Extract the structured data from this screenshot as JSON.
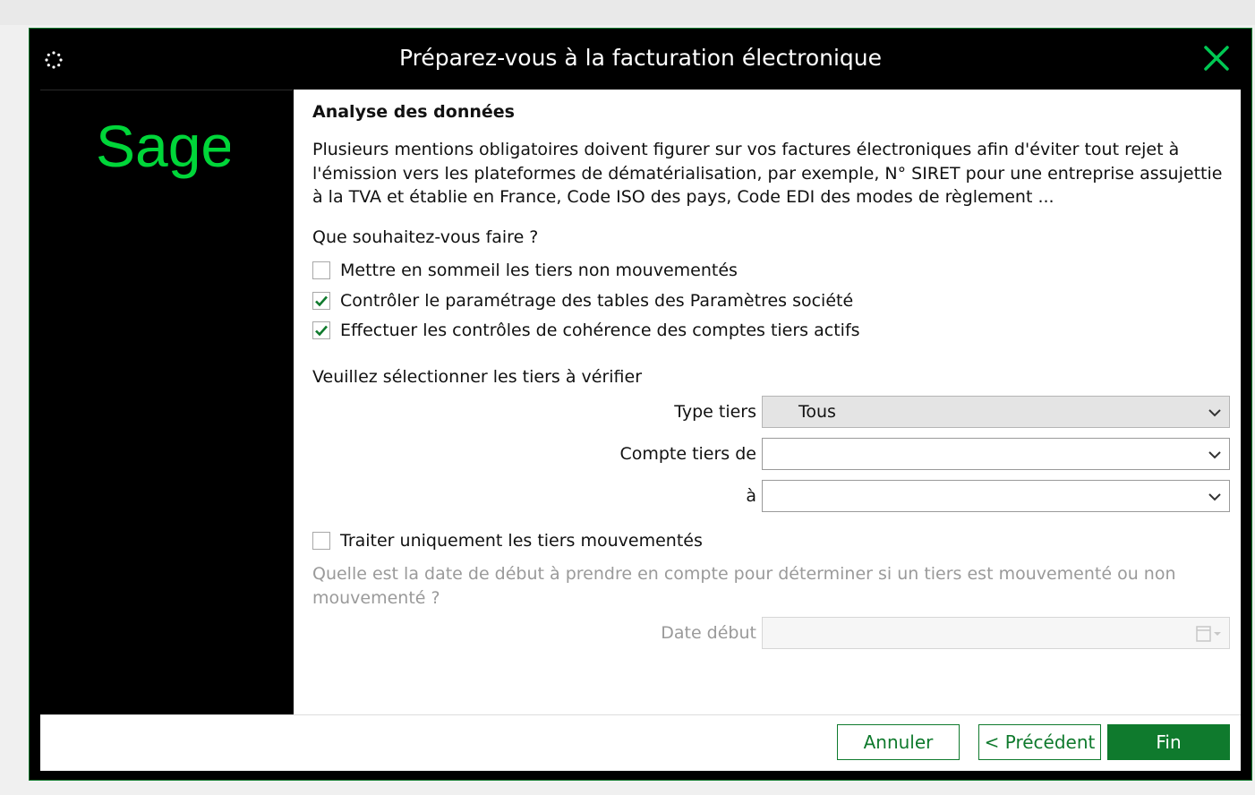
{
  "window": {
    "title": "Préparez-vous à la facturation électronique"
  },
  "sidebar": {
    "logo_text": "Sage"
  },
  "main": {
    "heading": "Analyse des données",
    "description": "Plusieurs mentions obligatoires doivent figurer sur vos factures électroniques afin d'éviter tout rejet à l'émission vers les plateformes de dématérialisation, par exemple, N° SIRET pour une entreprise assujettie à la TVA et établie en France, Code ISO des pays, Code EDI des modes de règlement ...",
    "question": "Que souhaitez-vous faire ?",
    "options": [
      {
        "label": "Mettre en sommeil les tiers non mouvementés",
        "checked": false
      },
      {
        "label": "Contrôler le paramétrage des tables des Paramètres société",
        "checked": true
      },
      {
        "label": "Effectuer les contrôles de cohérence des comptes tiers actifs",
        "checked": true
      }
    ],
    "select_title": "Veuillez sélectionner les tiers à vérifier",
    "type_tiers": {
      "label": "Type tiers",
      "value": "Tous"
    },
    "compte_de": {
      "label": "Compte tiers de",
      "value": ""
    },
    "compte_a": {
      "label": "à",
      "value": ""
    },
    "only_moved": {
      "label": "Traiter uniquement les tiers mouvementés",
      "checked": false
    },
    "date_hint": "Quelle est la date de début à prendre en compte pour déterminer si un tiers est mouvementé ou non mouvementé ?",
    "date_debut": {
      "label": "Date début",
      "value": ""
    }
  },
  "footer": {
    "cancel": "Annuler",
    "previous": "< Précédent",
    "finish": "Fin"
  },
  "colors": {
    "brand_green": "#00d639",
    "button_green": "#0f7a2d"
  }
}
